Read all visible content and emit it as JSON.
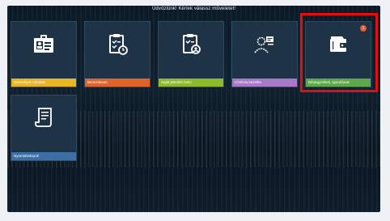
{
  "header": {
    "title": "Üdvözlünk! Kérlek válassz műveletet!"
  },
  "tiles": [
    {
      "label": "Személyes adataim",
      "bar_color": "#e8b625",
      "icon": "id-card-icon"
    },
    {
      "label": "Beosztásom",
      "bar_color": "#e0632a",
      "icon": "schedule-clipboard-icon"
    },
    {
      "label": "Saját jelenléti ívem",
      "bar_color": "#8dbb2c",
      "icon": "attendance-clipboard-icon"
    },
    {
      "label": "Címlista kezelés",
      "bar_color": "#a979c9",
      "icon": "contact-card-icon"
    },
    {
      "label": "Bérjegyzékek, igazolások",
      "bar_color": "#5da84a",
      "icon": "wallet-icon",
      "badge": "1"
    },
    {
      "label": "Nyomtatványok",
      "bar_color": "#3e6ea6",
      "icon": "document-icon"
    }
  ],
  "highlight_color": "#e60d0d"
}
